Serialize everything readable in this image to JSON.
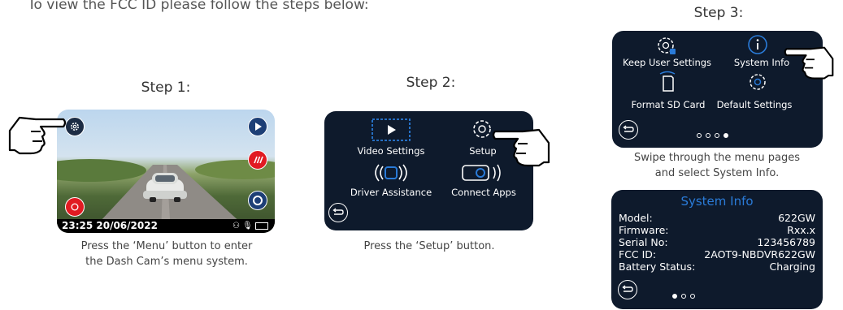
{
  "intro": "To view the FCC ID please follow the steps below:",
  "step1": {
    "label": "Step 1:",
    "caption_line1": "Press the ‘Menu’ button to enter",
    "caption_line2": "the Dash Cam’s menu system.",
    "timestamp": "23:25 20/06/2022"
  },
  "step2": {
    "label": "Step 2:",
    "caption": "Press the ‘Setup’ button.",
    "items": {
      "video_settings": "Video Settings",
      "setup": "Setup",
      "driver_assistance": "Driver Assistance",
      "connect_apps": "Connect Apps"
    }
  },
  "step3": {
    "label": "Step 3:",
    "caption_line1": "Swipe through the menu pages",
    "caption_line2": "and select System Info.",
    "items": {
      "keep_user_settings": "Keep User Settings",
      "system_info": "System Info",
      "format_sd_card": "Format SD Card",
      "default_settings": "Default Settings"
    },
    "page_dots": 4,
    "active_dot": 4
  },
  "system_info": {
    "title": "System Info",
    "rows": [
      {
        "key": "Model:",
        "value": "622GW"
      },
      {
        "key": "Firmware:",
        "value": "Rxx.x"
      },
      {
        "key": "Serial No:",
        "value": "123456789"
      },
      {
        "key": "FCC ID:",
        "value": "2AOT9-NBDVR622GW"
      },
      {
        "key": "Battery Status:",
        "value": "Charging"
      }
    ],
    "page_dots": 3,
    "active_dot": 1
  },
  "colors": {
    "menu_bg": "#0e1a2c",
    "accent_blue": "#2a7bd8",
    "record_red": "#e11b22"
  }
}
